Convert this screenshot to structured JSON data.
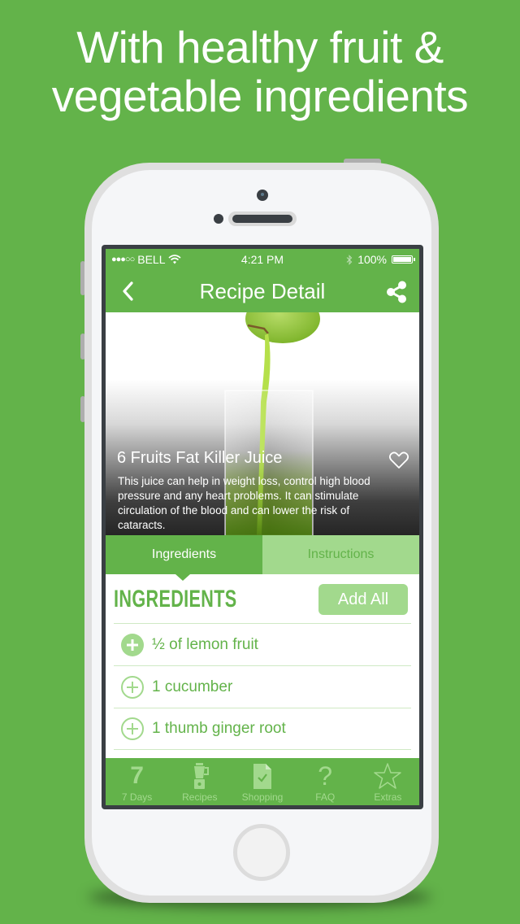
{
  "headline": {
    "line1": "With healthy fruit &",
    "line2": "vegetable ingredients"
  },
  "colors": {
    "brand_green": "#63b34a",
    "light_green": "#a2d98d",
    "divider_green": "#cfe9c4",
    "phone_dark": "#3a3f44"
  },
  "statusbar": {
    "signal": "●●●○○",
    "carrier": "BELL",
    "wifi_icon": "wifi-icon",
    "time": "4:21 PM",
    "bluetooth_icon": "bluetooth-icon",
    "battery": "100%"
  },
  "navbar": {
    "back_icon": "chevron-left-icon",
    "title": "Recipe Detail",
    "share_icon": "share-icon"
  },
  "recipe": {
    "title": "6 Fruits Fat Killer Juice",
    "favorite_icon": "heart-outline-icon",
    "description": "This juice can help in weight loss, control high blood pressure and any heart problems. It can stimulate circulation of the blood and can lower the risk of cataracts."
  },
  "tabs": [
    {
      "label": "Ingredients",
      "active": true
    },
    {
      "label": "Instructions",
      "active": false
    }
  ],
  "ingredients_section": {
    "title": "INGREDIENTS",
    "add_all_label": "Add All",
    "items": [
      {
        "text": "½ of lemon fruit",
        "added": true
      },
      {
        "text": "1 cucumber",
        "added": false
      },
      {
        "text": "1 thumb ginger root",
        "added": false
      }
    ]
  },
  "tabbar": [
    {
      "label": "7 Days",
      "icon": "seven-days-icon",
      "glyph": "7"
    },
    {
      "label": "Recipes",
      "icon": "blender-icon"
    },
    {
      "label": "Shopping",
      "icon": "shopping-list-icon"
    },
    {
      "label": "FAQ",
      "icon": "question-icon",
      "glyph": "?"
    },
    {
      "label": "Extras",
      "icon": "star-icon"
    }
  ]
}
